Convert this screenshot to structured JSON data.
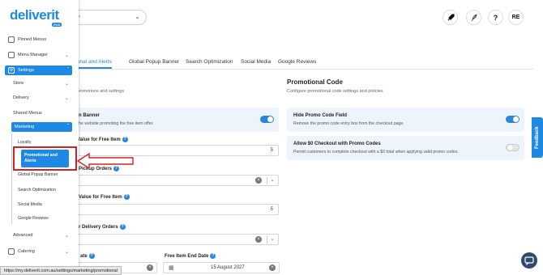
{
  "brand": {
    "logo": "deliverit",
    "logo_sub": "ewa",
    "accent": "#1e88e5",
    "annotation_color": "#d32027"
  },
  "topbar": {
    "location_value": "›",
    "profile_initials": "RE",
    "help_glyph": "?"
  },
  "tabs": [
    {
      "label": "otional and Alerts",
      "active": true
    },
    {
      "label": "Global Popup Banner"
    },
    {
      "label": "Search Optimization"
    },
    {
      "label": "Social Media"
    },
    {
      "label": "Google Reviews"
    }
  ],
  "left_section": {
    "desc": "n promotions and settings"
  },
  "free_item_banner": {
    "title": "n Banner",
    "desc": "he website promoting the free item offer."
  },
  "fields": {
    "min_pickup_label": "Value for Free Item",
    "min_pickup_value": "5",
    "pickup_orders_label": "Pickup Orders",
    "min_delivery_label": "y Value for Free Item",
    "min_delivery_value": "5",
    "delivery_orders_label": "r Delivery Orders",
    "start_date_label": "ate",
    "end_date_label": "Free Item End Date",
    "end_date_value": "15 August 2027"
  },
  "promo": {
    "title": "Promotional Code",
    "desc": "Configure promotional code settings and policies",
    "hide_title": "Hide Promo Code Field",
    "hide_desc": "Remove the promo code entry box from the checkout page.",
    "allow_title": "Allow $0 Checkout with Promo Codes",
    "allow_desc": "Permit customers to complete checkout with a $0 total when applying valid promo codes."
  },
  "sidebar": {
    "items": [
      {
        "label": "Pinned Menus"
      },
      {
        "label": "Menu Manager"
      },
      {
        "label": "Settings"
      },
      {
        "label": "Store"
      },
      {
        "label": "Delivery"
      },
      {
        "label": "Shared Menus"
      },
      {
        "label": "Marketing"
      },
      {
        "label": "Loyalty"
      },
      {
        "label": "Promotional and Alerts"
      },
      {
        "label": "Global Popup Banner"
      },
      {
        "label": "Search Optimization"
      },
      {
        "label": "Social Media"
      },
      {
        "label": "Google Reviews"
      },
      {
        "label": "Advanced"
      },
      {
        "label": "Catering"
      }
    ]
  },
  "feedback_label": "Feedback",
  "status_url": "https://my.deliverit.com.au/settings/marketing/promotional"
}
